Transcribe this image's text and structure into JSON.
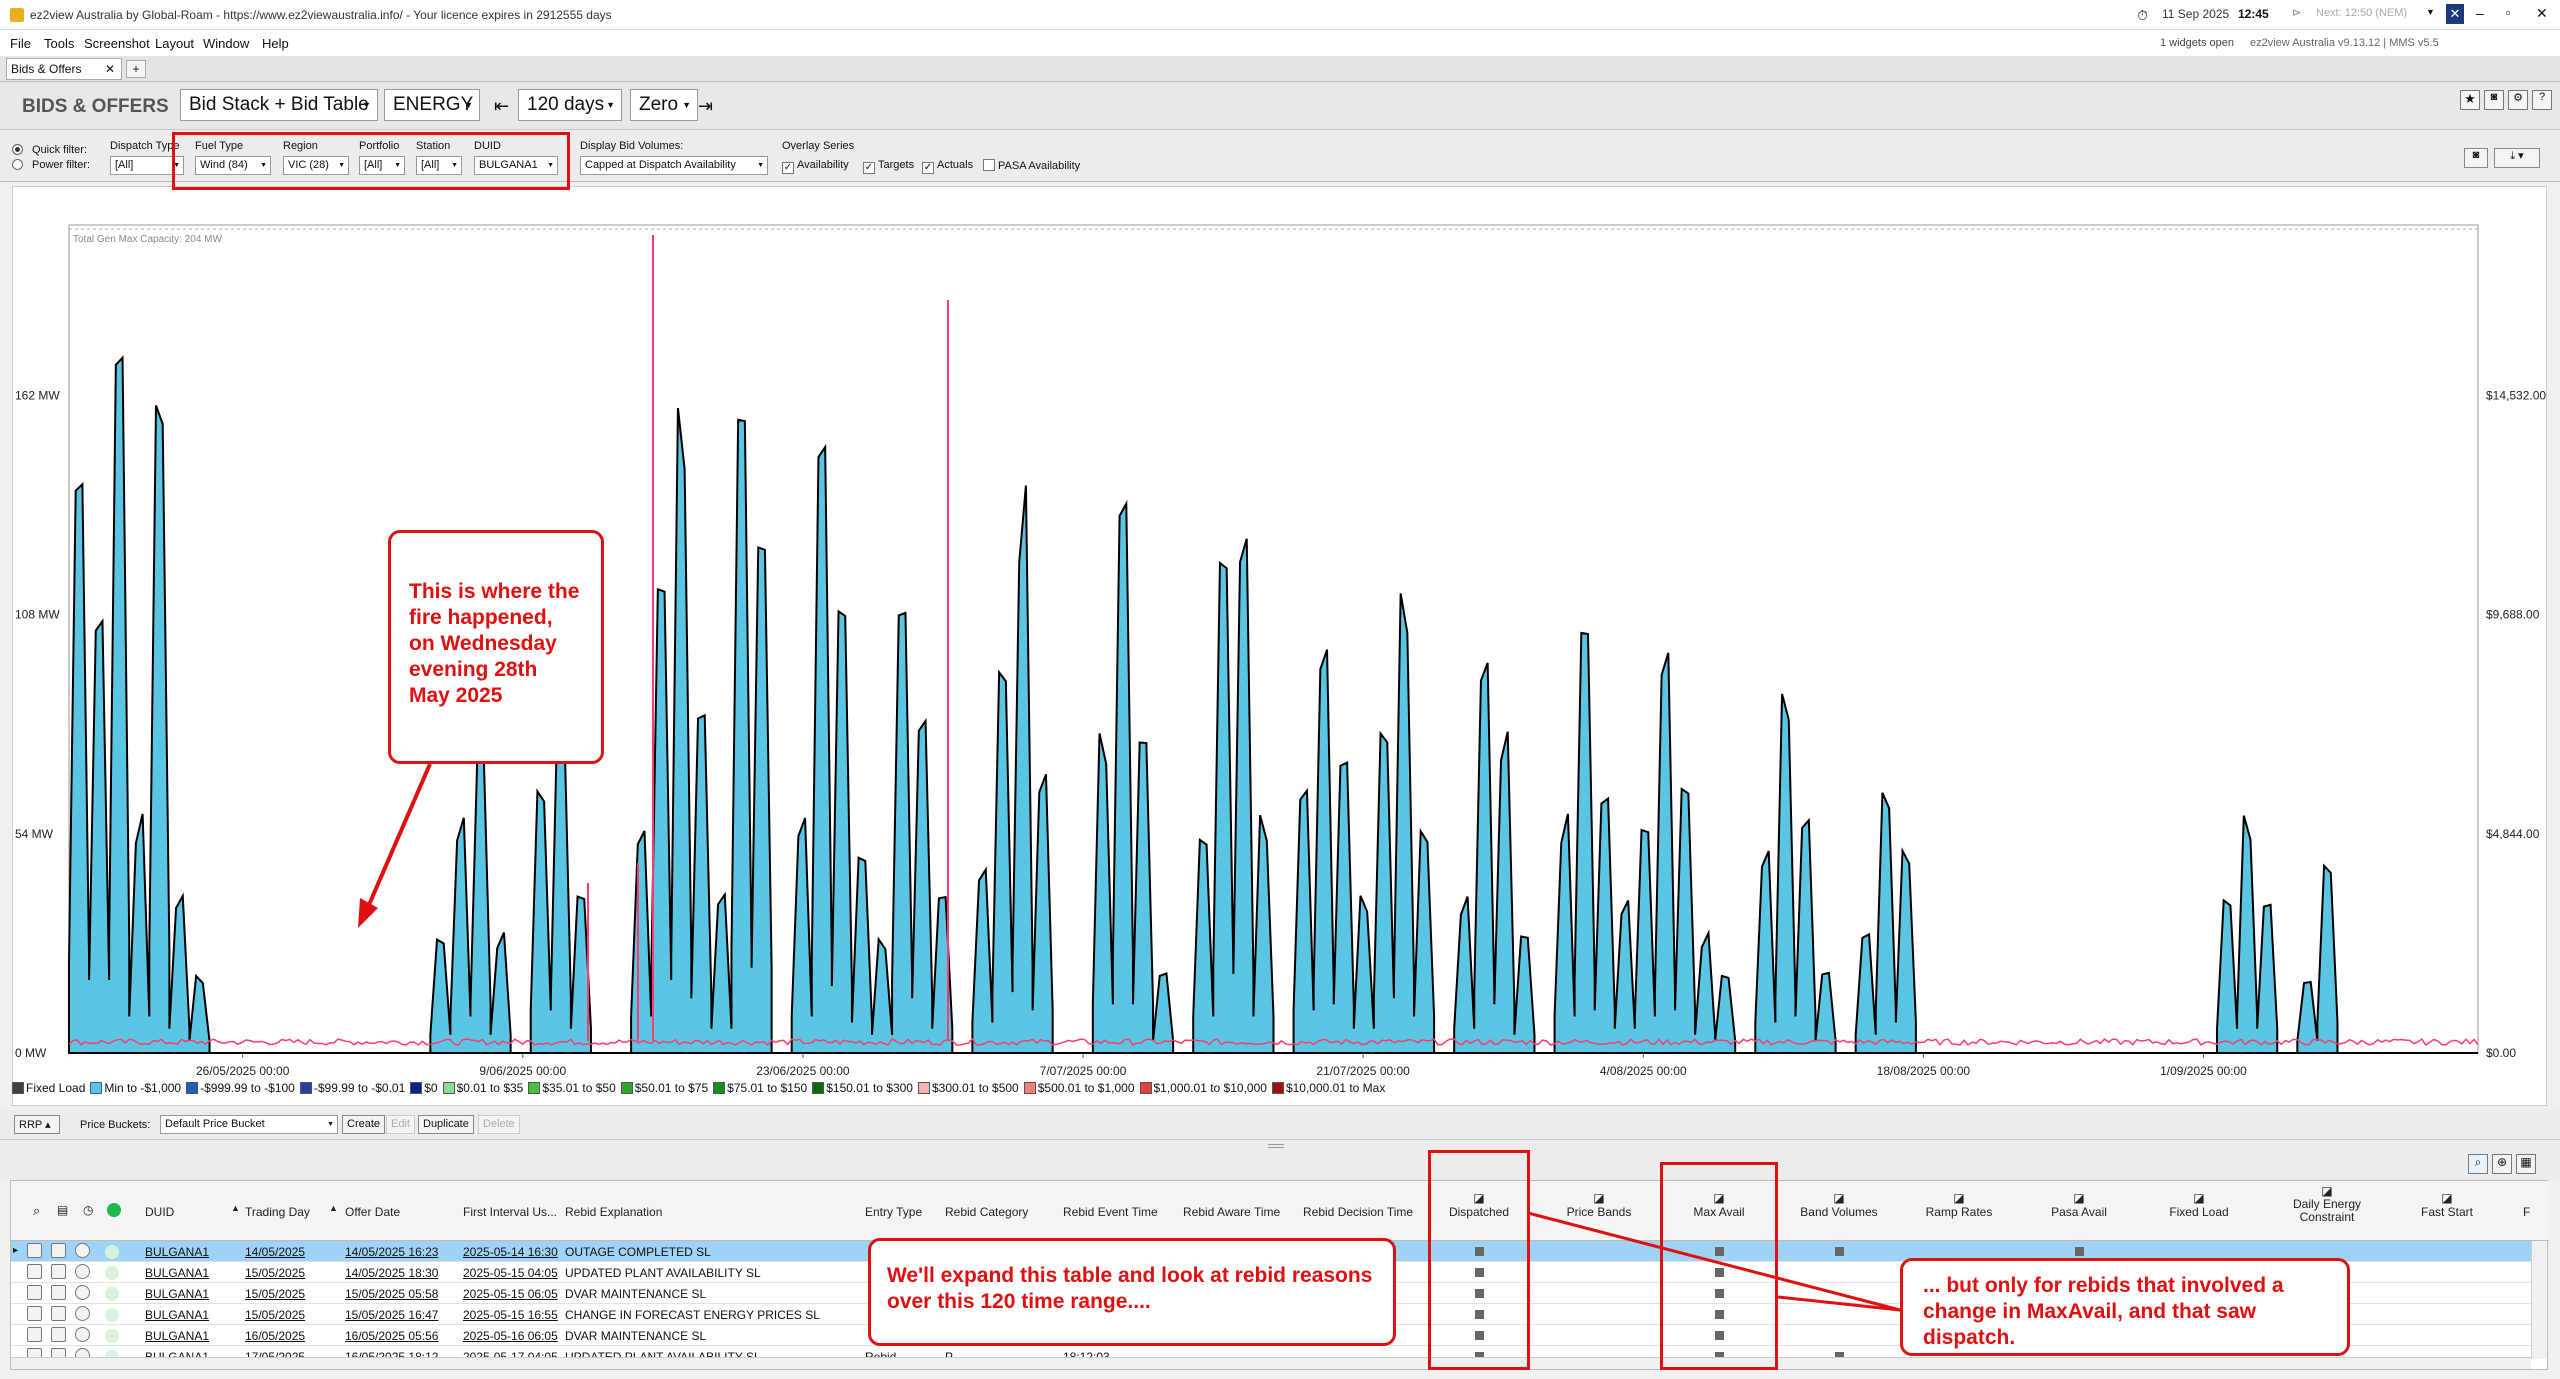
{
  "window": {
    "title": "ez2view Australia by Global-Roam - https://www.ez2viewaustralia.info/ - Your licence expires in 2912555 days"
  },
  "menu": [
    "File",
    "Tools",
    "Screenshot",
    "Layout",
    "Window",
    "Help"
  ],
  "tab": {
    "label": "Bids & Offers",
    "close": "✕",
    "add": "+"
  },
  "status": {
    "date": "11 Sep 2025",
    "time": "12:45",
    "next": "Next: 12:50 (NEM)",
    "widgets": "1 widgets open",
    "version": "ez2view Australia v9.13.12 | MMS v5.5"
  },
  "toolbar": {
    "title": "BIDS & OFFERS",
    "view": "Bid Stack + Bid Table",
    "market": "ENERGY",
    "range": "120 days",
    "baseline": "Zero"
  },
  "filters": {
    "quick_filter": "Quick filter:",
    "power_filter": "Power filter:",
    "dispatch_type": {
      "label": "Dispatch Type",
      "value": "[All]"
    },
    "fuel_type": {
      "label": "Fuel Type",
      "value": "Wind (84)"
    },
    "region": {
      "label": "Region",
      "value": "VIC (28)"
    },
    "portfolio": {
      "label": "Portfolio",
      "value": "[All]"
    },
    "station": {
      "label": "Station",
      "value": "[All]"
    },
    "duid": {
      "label": "DUID",
      "value": "BULGANA1"
    },
    "display_bid_volumes": {
      "label": "Display Bid Volumes:",
      "value": "Capped at Dispatch Availability"
    },
    "overlay": {
      "label": "Overlay Series",
      "items": [
        {
          "label": "Availability",
          "checked": true
        },
        {
          "label": "Targets",
          "checked": true
        },
        {
          "label": "Actuals",
          "checked": true
        },
        {
          "label": "PASA Availability",
          "checked": false
        }
      ]
    }
  },
  "chart_data": {
    "type": "area",
    "header_note": "Total Gen Max Capacity: 204 MW",
    "y_left_ticks": [
      "162 MW",
      "108 MW",
      "54 MW",
      "0 MW"
    ],
    "y_left_range": [
      0,
      204
    ],
    "y_right_ticks": [
      "$14,532.00",
      "$9,688.00",
      "$4,844.00",
      "$0.00"
    ],
    "x_ticks": [
      "26/05/2025 00:00",
      "9/06/2025 00:00",
      "23/06/2025 00:00",
      "7/07/2025 00:00",
      "21/07/2025 00:00",
      "4/08/2025 00:00",
      "18/08/2025 00:00",
      "1/09/2025 00:00"
    ],
    "x_range_days": 120,
    "series": [
      {
        "name": "Fixed Load",
        "color": "#404040"
      },
      {
        "name": "Min to -$1,000",
        "color": "#5bc5e4",
        "approx_daily_peak_mw": [
          150,
          120,
          185,
          60,
          170,
          40,
          20,
          0,
          0,
          0,
          0,
          0,
          0,
          0,
          0,
          0,
          0,
          0,
          30,
          60,
          80,
          30,
          0,
          70,
          90,
          40,
          0,
          0,
          60,
          120,
          160,
          90,
          40,
          170,
          140,
          0,
          60,
          150,
          110,
          50,
          30,
          120,
          90,
          40,
          0,
          50,
          100,
          140,
          70,
          0,
          0,
          80,
          155,
          80,
          20,
          0,
          60,
          140,
          130,
          60,
          0,
          70,
          110,
          80,
          40,
          90,
          120,
          60,
          0,
          40,
          100,
          80,
          30,
          0,
          60,
          120,
          70,
          40,
          60,
          100,
          70,
          30,
          20,
          0,
          50,
          90,
          60,
          20,
          0,
          30,
          70,
          50,
          0,
          0,
          0,
          0,
          0,
          0,
          0,
          0,
          0,
          0,
          0,
          0,
          0,
          0,
          0,
          40,
          60,
          40,
          0,
          20,
          50,
          0,
          0,
          0,
          0,
          0,
          0,
          0
        ]
      },
      {
        "name": "-$999.99 to -$100",
        "color": "#1f5fb5"
      },
      {
        "name": "-$99.99 to -$0.01",
        "color": "#2540a0"
      },
      {
        "name": "$0",
        "color": "#00218a"
      },
      {
        "name": "$0.01 to $35",
        "color": "#8fd98f"
      },
      {
        "name": "$35.01 to $50",
        "color": "#48c048"
      },
      {
        "name": "$50.01 to $75",
        "color": "#2aa82a"
      },
      {
        "name": "$75.01 to $150",
        "color": "#1a8a1a"
      },
      {
        "name": "$150.01 to $300",
        "color": "#0a6a0a"
      },
      {
        "name": "$300.01 to $500",
        "color": "#f5b0b0"
      },
      {
        "name": "$500.01 to $1,000",
        "color": "#f08080"
      },
      {
        "name": "$1,000.01 to $10,000",
        "color": "#e04040"
      },
      {
        "name": "$10,000.01 to Max",
        "color": "#a01010"
      }
    ],
    "legend_placement": "bottom",
    "grid": false
  },
  "bucket_bar": {
    "rrp": "RRP",
    "price_buckets_label": "Price Buckets:",
    "bucket_value": "Default Price Bucket",
    "create": "Create",
    "edit": "Edit",
    "duplicate": "Duplicate",
    "delete": "Delete"
  },
  "table": {
    "columns": [
      "DUID",
      "Trading Day",
      "Offer Date",
      "First Interval Us...",
      "Rebid Explanation",
      "Entry Type",
      "Rebid Category",
      "Rebid Event Time",
      "Rebid Aware Time",
      "Rebid Decision Time",
      "Dispatched",
      "Price Bands",
      "Max Avail",
      "Band Volumes",
      "Ramp Rates",
      "Pasa Avail",
      "Fixed Load",
      "Daily Energy Constraint",
      "Fast Start",
      "F"
    ],
    "rows": [
      {
        "duid": "BULGANA1",
        "trading_day": "14/05/2025",
        "offer_date": "14/05/2025 16:23",
        "first_interval": "2025-05-14 16:30",
        "explanation": "OUTAGE COMPLETED SL",
        "entry": "",
        "category": "",
        "event_time": "",
        "dispatched": true,
        "price_bands": false,
        "max_avail": true,
        "band_volumes": true,
        "pasa": true
      },
      {
        "duid": "BULGANA1",
        "trading_day": "15/05/2025",
        "offer_date": "14/05/2025 18:30",
        "first_interval": "2025-05-15 04:05",
        "explanation": "UPDATED PLANT AVAILABILITY SL",
        "entry": "",
        "category": "",
        "event_time": "",
        "dispatched": true,
        "price_bands": false,
        "max_avail": true,
        "band_volumes": false,
        "pasa": false
      },
      {
        "duid": "BULGANA1",
        "trading_day": "15/05/2025",
        "offer_date": "15/05/2025 05:58",
        "first_interval": "2025-05-15 06:05",
        "explanation": "DVAR MAINTENANCE SL",
        "entry": "",
        "category": "",
        "event_time": "",
        "dispatched": true,
        "price_bands": false,
        "max_avail": true,
        "band_volumes": false,
        "pasa": false
      },
      {
        "duid": "BULGANA1",
        "trading_day": "15/05/2025",
        "offer_date": "15/05/2025 16:47",
        "first_interval": "2025-05-15 16:55",
        "explanation": "CHANGE IN FORECAST ENERGY PRICES SL",
        "entry": "",
        "category": "",
        "event_time": "",
        "dispatched": true,
        "price_bands": false,
        "max_avail": true,
        "band_volumes": false,
        "pasa": false
      },
      {
        "duid": "BULGANA1",
        "trading_day": "16/05/2025",
        "offer_date": "16/05/2025 05:56",
        "first_interval": "2025-05-16 06:05",
        "explanation": "DVAR MAINTENANCE SL",
        "entry": "",
        "category": "",
        "event_time": "",
        "dispatched": true,
        "price_bands": false,
        "max_avail": true,
        "band_volumes": false,
        "pasa": false
      },
      {
        "duid": "BULGANA1",
        "trading_day": "17/05/2025",
        "offer_date": "16/05/2025 18:12",
        "first_interval": "2025-05-17 04:05",
        "explanation": "UPDATED PLANT AVAILABILITY SL",
        "entry": "Rebid",
        "category": "P",
        "event_time": "18:12:03",
        "dispatched": true,
        "price_bands": false,
        "max_avail": true,
        "band_volumes": true,
        "pasa": false
      }
    ]
  },
  "annotations": {
    "fire": "This is where the fire happened, on Wednesday evening 28th May 2025",
    "expand": "We'll expand this table and look at rebid reasons over this 120 time range....",
    "maxavail": "... but only for rebids that involved a change in MaxAvail, and that saw dispatch."
  },
  "colors": {
    "accent_red": "#e01010",
    "selected_row": "#9fd3f5",
    "area_fill": "#5bc5e4",
    "rrp_line": "#ff3a6e"
  }
}
